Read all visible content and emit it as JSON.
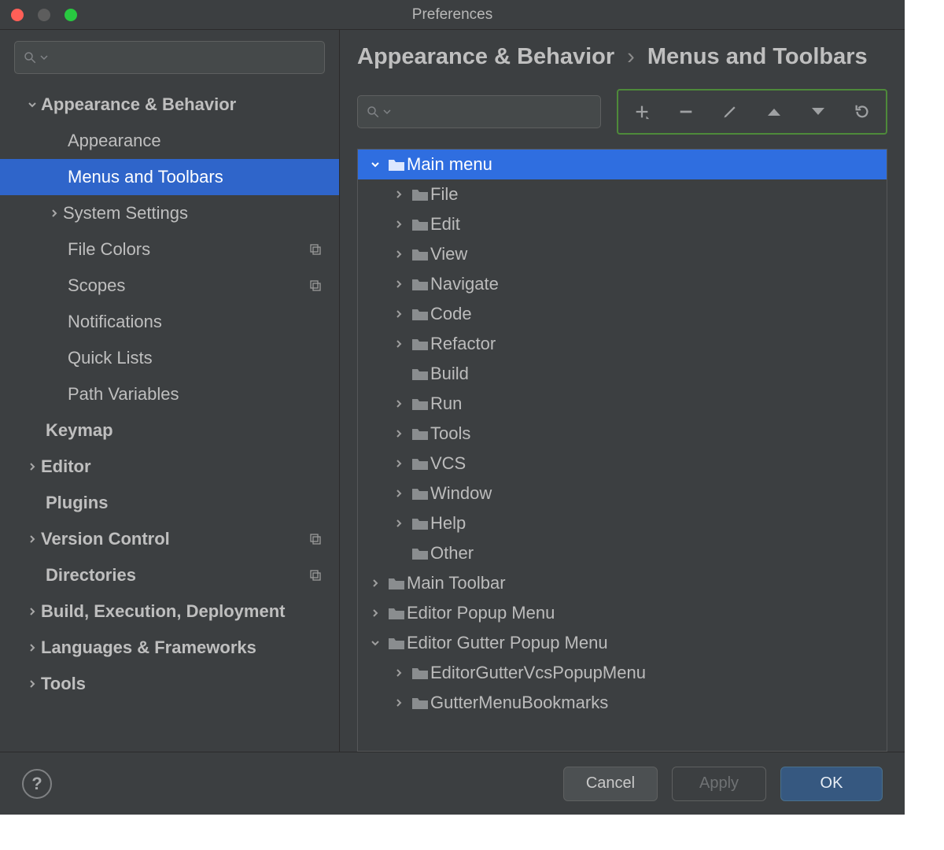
{
  "window": {
    "title": "Preferences"
  },
  "sidebar": {
    "search_placeholder": "",
    "items": [
      {
        "label": "Appearance & Behavior"
      },
      {
        "label": "Appearance"
      },
      {
        "label": "Menus and Toolbars"
      },
      {
        "label": "System Settings"
      },
      {
        "label": "File Colors"
      },
      {
        "label": "Scopes"
      },
      {
        "label": "Notifications"
      },
      {
        "label": "Quick Lists"
      },
      {
        "label": "Path Variables"
      },
      {
        "label": "Keymap"
      },
      {
        "label": "Editor"
      },
      {
        "label": "Plugins"
      },
      {
        "label": "Version Control"
      },
      {
        "label": "Directories"
      },
      {
        "label": "Build, Execution, Deployment"
      },
      {
        "label": "Languages & Frameworks"
      },
      {
        "label": "Tools"
      }
    ]
  },
  "breadcrumb": {
    "root": "Appearance & Behavior",
    "leaf": "Menus and Toolbars"
  },
  "toolbar": {
    "add": "add",
    "remove": "remove",
    "edit": "edit",
    "up": "up",
    "down": "down",
    "reset": "reset"
  },
  "tree": {
    "items": [
      {
        "label": "Main menu"
      },
      {
        "label": "File"
      },
      {
        "label": "Edit"
      },
      {
        "label": "View"
      },
      {
        "label": "Navigate"
      },
      {
        "label": "Code"
      },
      {
        "label": "Refactor"
      },
      {
        "label": "Build"
      },
      {
        "label": "Run"
      },
      {
        "label": "Tools"
      },
      {
        "label": "VCS"
      },
      {
        "label": "Window"
      },
      {
        "label": "Help"
      },
      {
        "label": "Other"
      },
      {
        "label": "Main Toolbar"
      },
      {
        "label": "Editor Popup Menu"
      },
      {
        "label": "Editor Gutter Popup Menu"
      },
      {
        "label": "EditorGutterVcsPopupMenu"
      },
      {
        "label": "GutterMenuBookmarks"
      }
    ]
  },
  "footer": {
    "cancel": "Cancel",
    "apply": "Apply",
    "ok": "OK"
  },
  "main_search_placeholder": ""
}
